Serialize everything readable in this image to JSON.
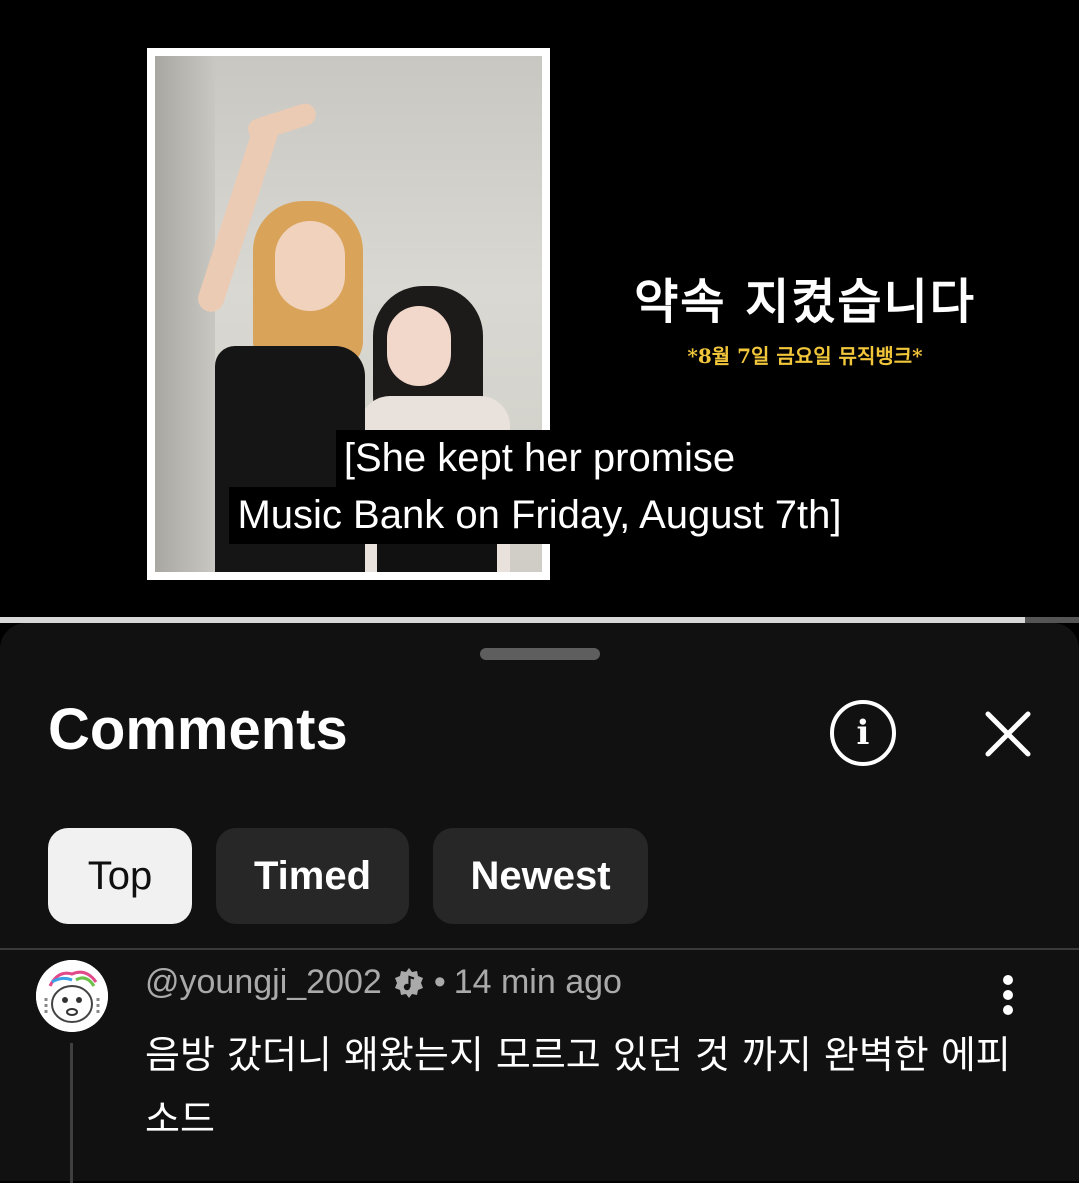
{
  "video": {
    "title_overlay": "약속 지켰습니다",
    "subtitle_overlay": "*8월 7일 금요일 뮤직뱅크*",
    "caption_lines": [
      "[She kept her promise",
      "Music Bank on Friday, August 7th]"
    ],
    "progress": 0.95,
    "colors": {
      "subtitle": "#f1c63b",
      "progress_fill": "#d7d7d7",
      "progress_track": "#555555"
    }
  },
  "comments_panel": {
    "title": "Comments",
    "info_icon": "info-icon",
    "close_icon": "close-icon",
    "filters": [
      {
        "label": "Top",
        "active": true
      },
      {
        "label": "Timed",
        "active": false
      },
      {
        "label": "Newest",
        "active": false
      }
    ]
  },
  "comment": {
    "author": "@youngji_2002",
    "badge_icon": "music-note-badge-icon",
    "separator": "•",
    "time": "14 min ago",
    "text": "음방 갔더니 왜왔는지 모르고 있던 것 까지 완벽한 에피소드",
    "more_icon": "more-vertical-icon"
  }
}
